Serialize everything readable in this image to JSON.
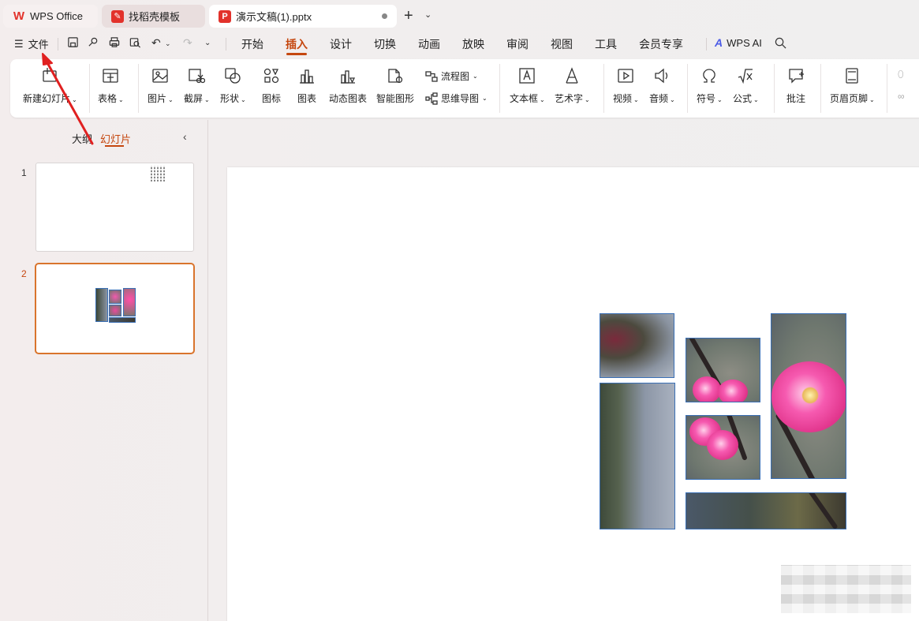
{
  "tabs": [
    {
      "label": "WPS Office",
      "icon": "wps-logo-icon"
    },
    {
      "label": "找稻壳模板",
      "icon": "docer-icon"
    },
    {
      "label": "演示文稿(1).pptx",
      "icon": "ppt-file-icon",
      "active": true
    }
  ],
  "menu": {
    "file_label": "文件",
    "tabs": [
      "开始",
      "插入",
      "设计",
      "切换",
      "动画",
      "放映",
      "审阅",
      "视图",
      "工具",
      "会员专享"
    ],
    "active_tab": "插入",
    "ai_label": "WPS AI"
  },
  "ribbon": {
    "new_slide": "新建幻灯片",
    "table": "表格",
    "picture": "图片",
    "screenshot": "截屏",
    "shape": "形状",
    "icon": "图标",
    "chart": "图表",
    "dynamic_chart": "动态图表",
    "smart_graphic": "智能图形",
    "flowchart": "流程图",
    "mindmap": "思维导图",
    "textbox": "文本框",
    "wordart": "艺术字",
    "video": "视频",
    "audio": "音频",
    "symbol": "符号",
    "formula": "公式",
    "comment": "批注",
    "header_footer": "页眉页脚"
  },
  "left_panel": {
    "tab_outline": "大纲",
    "tab_slides": "幻灯片",
    "active_tab": "幻灯片",
    "slides": [
      {
        "number": "1"
      },
      {
        "number": "2",
        "selected": true
      }
    ]
  },
  "colors": {
    "accent": "#c5470f",
    "selection": "#d9742c",
    "picture_border": "#3a6fb5"
  }
}
